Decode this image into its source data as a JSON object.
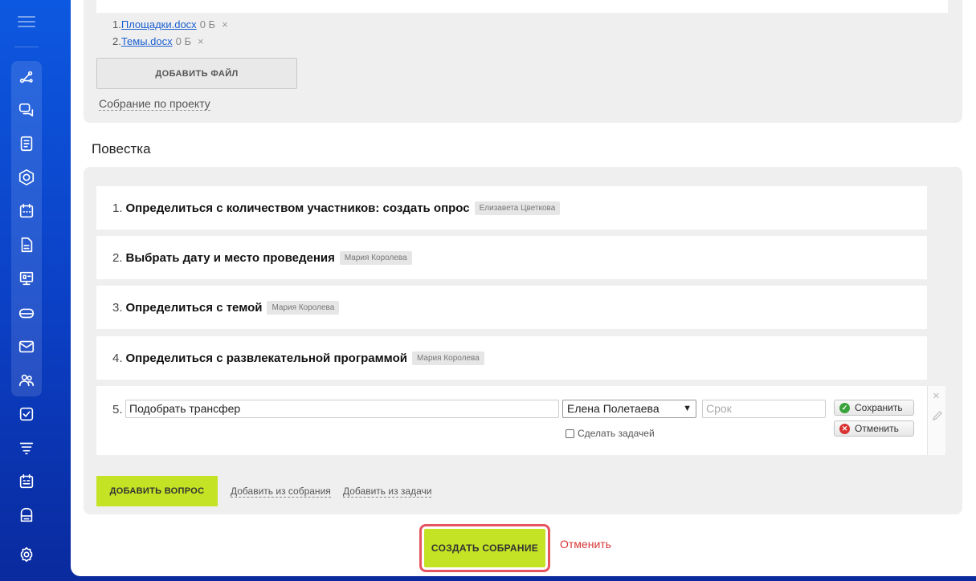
{
  "sidebar": {
    "menu_icon": "hamburger-icon",
    "icons": [
      "network-icon",
      "chat-icon",
      "document-list-icon",
      "hexagon-icon",
      "calendar-icon",
      "file-icon",
      "presentation-icon",
      "drive-icon",
      "mail-icon",
      "users-icon",
      "checkbox-icon",
      "filter-icon",
      "schedule-icon",
      "archive-icon",
      "settings-icon"
    ]
  },
  "files": {
    "items": [
      {
        "num": "1.",
        "name": "Площадки.docx",
        "size": "0 Б",
        "remove": "×"
      },
      {
        "num": "2.",
        "name": "Темы.docx",
        "size": "0 Б",
        "remove": "×"
      }
    ],
    "add_button": "ДОБАВИТЬ ФАЙЛ",
    "project_link": "Собрание по проекту"
  },
  "agenda": {
    "title": "Повестка",
    "items": [
      {
        "num": "1.",
        "text": "Определиться с количеством участников: создать опрос",
        "assignee": "Елизавета Цветкова"
      },
      {
        "num": "2.",
        "text": "Выбрать дату и место проведения",
        "assignee": "Мария Королева"
      },
      {
        "num": "3.",
        "text": "Определиться с темой",
        "assignee": "Мария Королева"
      },
      {
        "num": "4.",
        "text": "Определиться с развлекательной программой",
        "assignee": "Мария Королева"
      }
    ],
    "edit": {
      "num": "5.",
      "text_value": "Подобрать трансфер",
      "assignee_value": "Елена Полетаева",
      "date_placeholder": "Срок",
      "task_checkbox_label": "Сделать задачей",
      "save_label": "Сохранить",
      "cancel_label": "Отменить",
      "close_glyph": "×"
    },
    "add_question": "ДОБАВИТЬ ВОПРОС",
    "add_from_meeting": "Добавить из собрания",
    "add_from_task": "Добавить из задачи"
  },
  "footer": {
    "create_button": "СОЗДАТЬ СОБРАНИЕ",
    "cancel_link": "Отменить"
  },
  "colors": {
    "accent_green": "#c4e324",
    "sidebar_blue": "#0d58e0",
    "link_blue": "#1a5fd0",
    "cancel_red": "#d93535",
    "highlight_outline": "#e5555f"
  }
}
